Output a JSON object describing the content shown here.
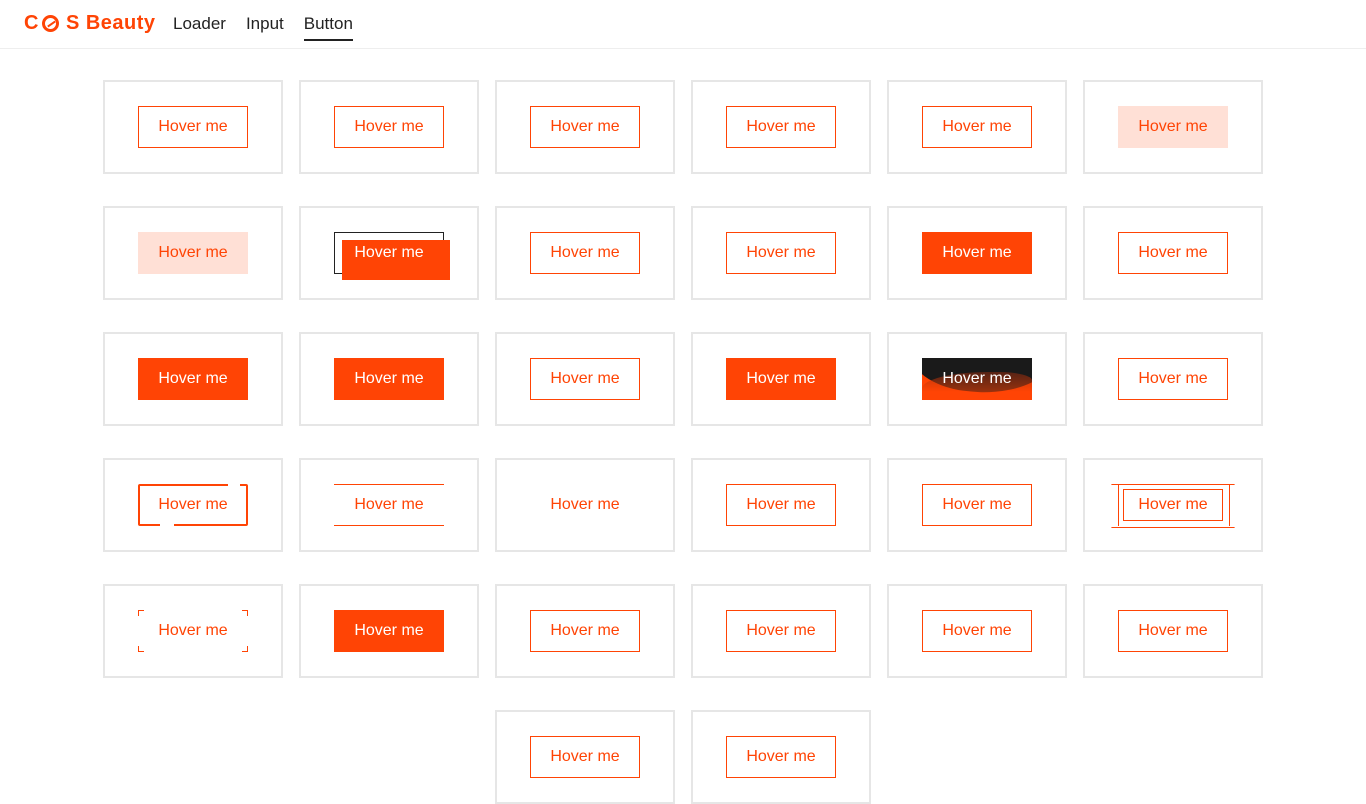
{
  "header": {
    "logo_parts": [
      "C",
      "S Beauty"
    ],
    "nav": [
      {
        "label": "Loader",
        "active": false
      },
      {
        "label": "Input",
        "active": false
      },
      {
        "label": "Button",
        "active": true
      }
    ]
  },
  "button_label": "Hover me",
  "buttons": [
    {
      "label": "Hover me",
      "style": "outline"
    },
    {
      "label": "Hover me",
      "style": "outline"
    },
    {
      "label": "Hover me",
      "style": "outline"
    },
    {
      "label": "Hover me",
      "style": "outline"
    },
    {
      "label": "Hover me",
      "style": "outline"
    },
    {
      "label": "Hover me",
      "style": "soft"
    },
    {
      "label": "Hover me",
      "style": "soft"
    },
    {
      "label": "Hover me",
      "style": "offset"
    },
    {
      "label": "Hover me",
      "style": "outline"
    },
    {
      "label": "Hover me",
      "style": "outline"
    },
    {
      "label": "Hover me",
      "style": "filled"
    },
    {
      "label": "Hover me",
      "style": "outline"
    },
    {
      "label": "Hover me",
      "style": "filled"
    },
    {
      "label": "Hover me",
      "style": "filled"
    },
    {
      "label": "Hover me",
      "style": "outline"
    },
    {
      "label": "Hover me",
      "style": "filled"
    },
    {
      "label": "Hover me",
      "style": "dark"
    },
    {
      "label": "Hover me",
      "style": "outline"
    },
    {
      "label": "Hover me",
      "style": "gapped"
    },
    {
      "label": "Hover me",
      "style": "lines"
    },
    {
      "label": "Hover me",
      "style": "plain"
    },
    {
      "label": "Hover me",
      "style": "outline"
    },
    {
      "label": "Hover me",
      "style": "outline"
    },
    {
      "label": "Hover me",
      "style": "cross"
    },
    {
      "label": "Hover me",
      "style": "corners"
    },
    {
      "label": "Hover me",
      "style": "filled"
    },
    {
      "label": "Hover me",
      "style": "outline"
    },
    {
      "label": "Hover me",
      "style": "outline"
    },
    {
      "label": "Hover me",
      "style": "outline"
    },
    {
      "label": "Hover me",
      "style": "outline"
    },
    {
      "label": "Hover me",
      "style": "outline"
    },
    {
      "label": "Hover me",
      "style": "outline"
    }
  ],
  "colors": {
    "accent": "#ff4405",
    "soft": "#ffe0d6",
    "border": "#e6e6e6",
    "text": "#222222"
  }
}
